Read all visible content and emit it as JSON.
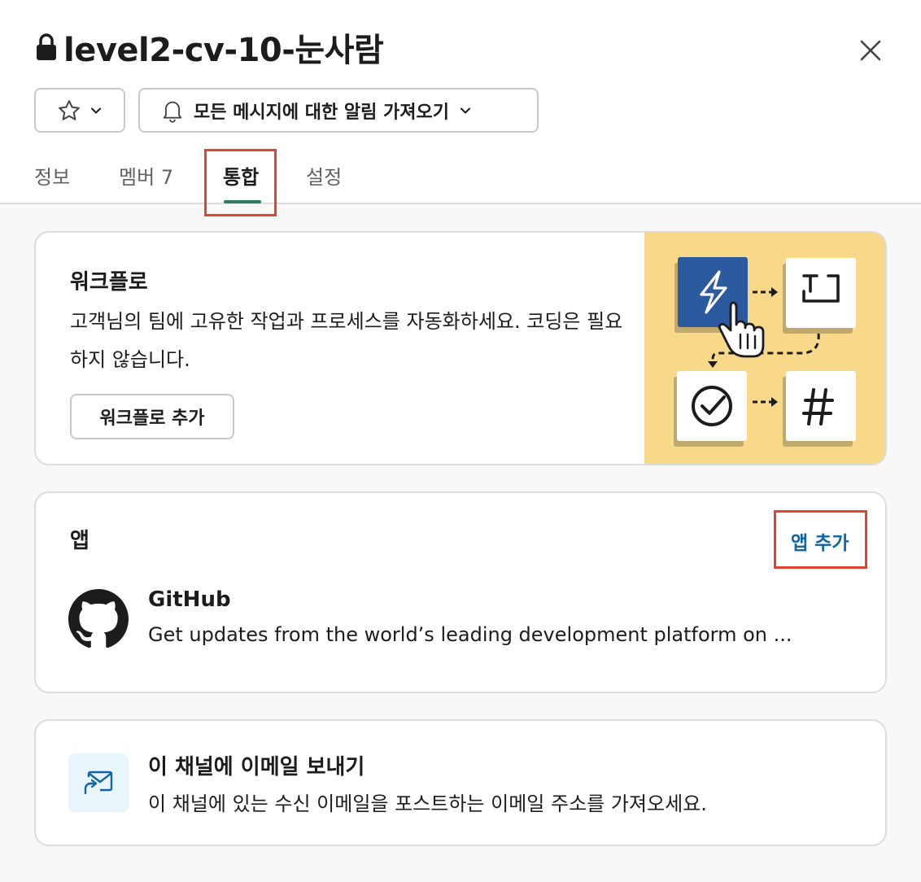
{
  "channel": {
    "name": "level2-cv-10-눈사람",
    "private": true
  },
  "header": {
    "notifications_label": "모든 메시지에 대한 알림 가져오기"
  },
  "tabs": [
    {
      "label": "정보",
      "count": ""
    },
    {
      "label": "멤버",
      "count": "7"
    },
    {
      "label": "통합",
      "count": "",
      "active": true
    },
    {
      "label": "설정",
      "count": ""
    }
  ],
  "workflow": {
    "title": "워크플로",
    "description": "고객님의 팀에 고유한 작업과 프로세스를 자동화하세요. 코딩은 필요하지 않습니다.",
    "button_label": "워크플로 추가"
  },
  "apps": {
    "title": "앱",
    "add_label": "앱 추가",
    "items": [
      {
        "name": "GitHub",
        "description": "Get updates from the world’s leading development platform on ..."
      }
    ]
  },
  "email": {
    "title": "이 채널에 이메일 보내기",
    "description": "이 채널에 있는 수신 이메일을 포스트하는 이메일 주소를 가져오세요."
  },
  "icons": {
    "lock": "lock-icon",
    "close": "close-icon",
    "star": "star-icon",
    "bell": "bell-icon",
    "chevron": "chevron-down-icon",
    "github": "github-icon",
    "email": "email-forward-icon"
  },
  "colors": {
    "accent_tab": "#2e7d5b",
    "link": "#1264a3",
    "highlight": "#e0442e",
    "illustration_bg": "#f8d98a",
    "illustration_tile": "#2c5a9e"
  }
}
